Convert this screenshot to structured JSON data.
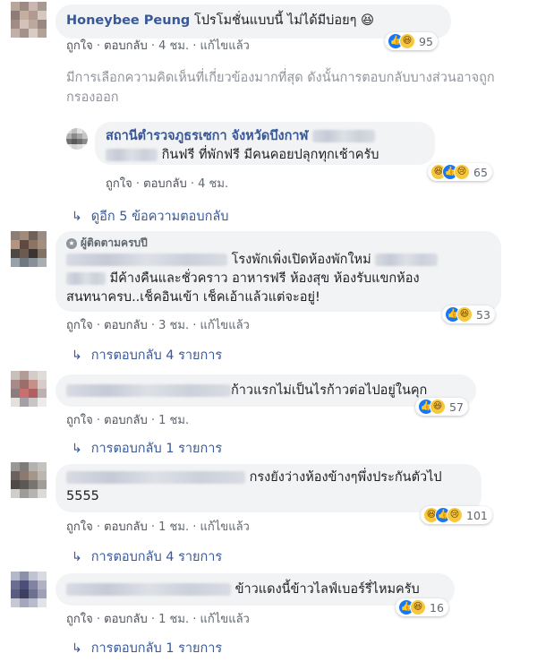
{
  "comments": [
    {
      "author": "Honeybee Peung",
      "text": "โปรโมชั่นแบบนี้ ไม่ได้มีบ่อยๆ 😆",
      "like": "ถูกใจ",
      "reply": "ตอบกลับ",
      "time": "4 ชม.",
      "edited": "แก้ไขแล้ว",
      "reactions": [
        "like",
        "haha"
      ],
      "reaction_count": "95"
    },
    {
      "notice": "มีการเลือกความคิดเห็นที่เกี่ยวข้องมากที่สุด ดังนั้นการตอบกลับบางส่วนอาจถูกกรองออก"
    },
    {
      "author": "สถานีตำรวจภูธรเซกา จังหวัดบึงกาฬ",
      "text": "กินฟรี ที่พักฟรี มีคนคอยปลุกทุกเช้าครับ",
      "like": "ถูกใจ",
      "reply": "ตอบกลับ",
      "time": "4 ชม.",
      "reactions": [
        "haha",
        "like",
        "sad"
      ],
      "reaction_count": "65",
      "more_replies": "ดูอีก 5 ข้อความตอบกลับ"
    },
    {
      "badge": "ผู้ติดตามครบปี",
      "text_1": "โรงพักเพิ่งเปิดห้องพักใหม่",
      "text_2": "มีค้างคืนและชั่วคราว อาหารฟรี ห้องสุข ห้องรับแขกห้อง",
      "text_3": "สนทนาครบ..เช็คอินเข้า เช็คเอ้าแล้วแต่จะอยู่!",
      "like": "ถูกใจ",
      "reply": "ตอบกลับ",
      "time": "3 ชม.",
      "edited": "แก้ไขแล้ว",
      "reactions": [
        "like",
        "haha"
      ],
      "reaction_count": "53",
      "replies": "การตอบกลับ 4 รายการ"
    },
    {
      "text": "ก้าวแรกไม่เป็นไรก้าวต่อไปอยู่ในคุก",
      "like": "ถูกใจ",
      "reply": "ตอบกลับ",
      "time": "1 ชม.",
      "reactions": [
        "like",
        "haha"
      ],
      "reaction_count": "57",
      "replies": "การตอบกลับ 1 รายการ"
    },
    {
      "text_1": "กรงยังว่างห้องข้างๆพึ่งประกันตัวไป",
      "text_2": "5555",
      "like": "ถูกใจ",
      "reply": "ตอบกลับ",
      "time": "1 ชม.",
      "edited": "แก้ไขแล้ว",
      "reactions": [
        "haha",
        "like",
        "sad"
      ],
      "reaction_count": "101",
      "replies": "การตอบกลับ 4 รายการ"
    },
    {
      "text": "ข้าวแดงนี้ข้าวไลฟ์เบอร์รี่ไหมครับ",
      "like": "ถูกใจ",
      "reply": "ตอบกลับ",
      "time": "1 ชม.",
      "edited": "แก้ไขแล้ว",
      "reactions": [
        "like",
        "haha"
      ],
      "reaction_count": "16",
      "replies": "การตอบกลับ 1 รายการ"
    }
  ],
  "sep": "·",
  "colors": {
    "link": "#385898",
    "bubble": "#f2f3f5",
    "like": "#1877f2",
    "haha": "#f7c83c"
  },
  "icons": {
    "reply_arrow": "reply-arrow-icon",
    "like": "like-reaction-icon",
    "haha": "haha-reaction-icon",
    "sad": "sad-reaction-icon"
  }
}
